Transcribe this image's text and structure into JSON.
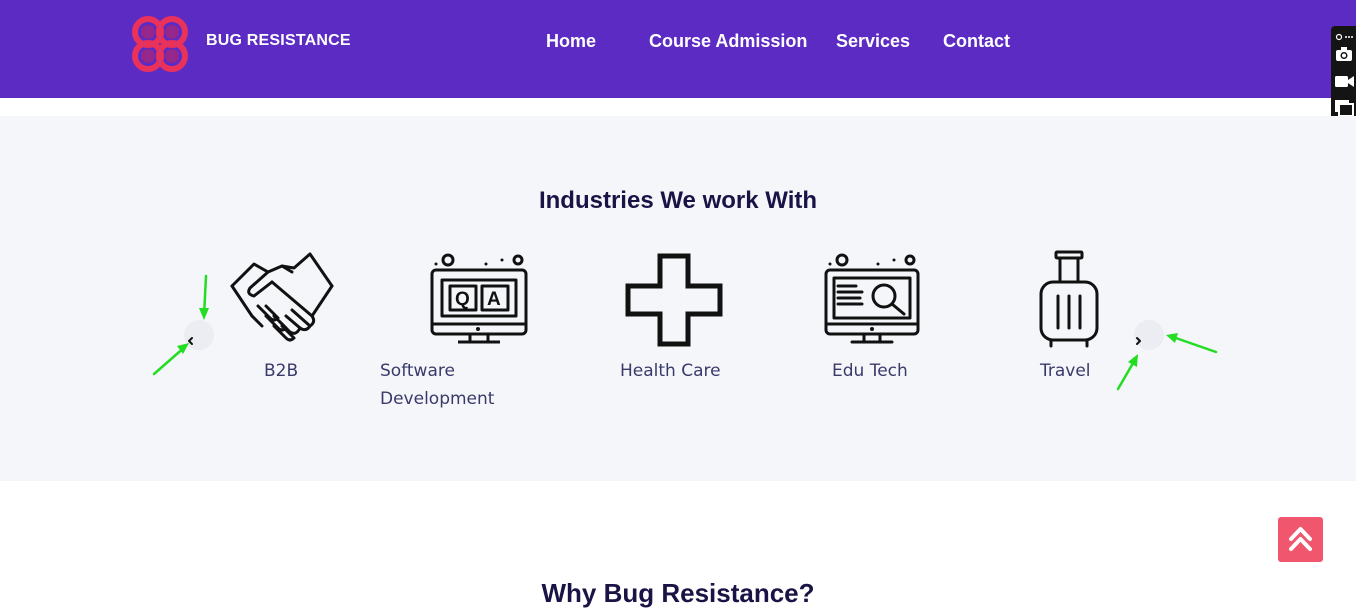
{
  "header": {
    "brand": "BUG RESISTANCE",
    "logo_icon": "four-petal-flower-logo",
    "nav": [
      {
        "label": "Home"
      },
      {
        "label": "Course Admission"
      },
      {
        "label": "Services"
      },
      {
        "label": "Contact"
      }
    ]
  },
  "industries": {
    "title": "Industries We work With",
    "items": [
      {
        "label": "B2B",
        "icon": "handshake-icon"
      },
      {
        "label": "Software Development",
        "icon": "qa-monitor-icon"
      },
      {
        "label": "Health Care",
        "icon": "medical-cross-icon"
      },
      {
        "label": "Edu Tech",
        "icon": "search-monitor-icon"
      },
      {
        "label": "Travel",
        "icon": "suitcase-icon"
      }
    ],
    "prev_icon": "chevron-left-icon",
    "next_icon": "chevron-right-icon"
  },
  "next_section": {
    "title": "Why Bug Resistance?"
  },
  "colors": {
    "header_bg": "#5c2bc4",
    "section_bg": "#f5f6fa",
    "accent": "#f0566e",
    "logo": "#e8315b",
    "annotation": "#22dd22"
  }
}
